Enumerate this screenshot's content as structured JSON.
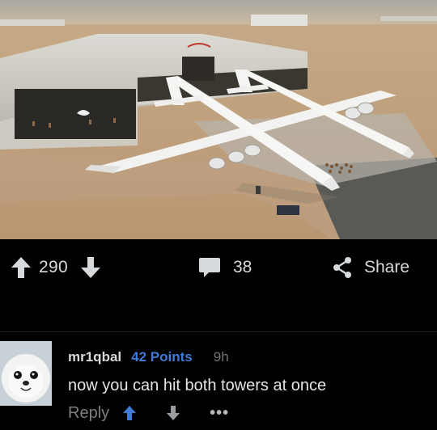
{
  "post": {
    "score": "290",
    "comment_count": "38",
    "share_label": "Share"
  },
  "comment": {
    "username": "mr1qbal",
    "points": "42 Points",
    "age": "9h",
    "body": "now you can hit both towers at once",
    "reply_label": "Reply",
    "more_label": "•••"
  },
  "colors": {
    "background": "#000000",
    "text": "#d7dadc",
    "points_blue": "#3d7bd6",
    "muted": "#7c7f82"
  },
  "icons": {
    "upvote": "arrow-up-icon",
    "downvote": "arrow-down-icon",
    "comments": "speech-bubble-icon",
    "share": "share-icon",
    "reply_upvote": "arrow-up-icon-blue",
    "reply_downvote": "arrow-down-icon"
  }
}
